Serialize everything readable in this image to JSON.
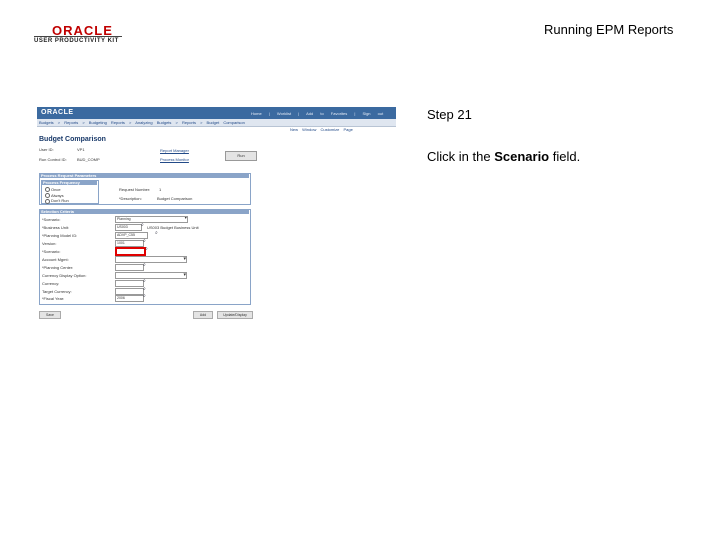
{
  "header": {
    "logo_text": "ORACLE",
    "logo_subtext": "USER PRODUCTIVITY KIT",
    "title": "Running EPM Reports"
  },
  "step": {
    "label": "Step 21",
    "instruction_prefix": "Click in the ",
    "instruction_field": "Scenario",
    "instruction_suffix": " field."
  },
  "screenshot": {
    "brand": "ORACLE",
    "top_links": "Home | Worklist | Add to Favorites | Sign out",
    "nav_links": "Budgets > Reports > Budgeting Reports > Analyzing Budgets > Reports > Budget Comparison",
    "util_links": "New Window  Customize Page",
    "page_title": "Budget Comparison",
    "fields": {
      "user_id_label": "User ID:",
      "user_id_value": "VP1",
      "run_control_label": "Run Control ID:",
      "run_control_value": "BUD_COMP",
      "report_manager": "Report Manager",
      "process_monitor": "Process Monitor",
      "run_button": "Run"
    },
    "process_section": {
      "header": "Process Request Parameters",
      "frequency_header": "Process Frequency",
      "options": [
        "Once",
        "Always",
        "Don't Run"
      ],
      "request_number_label": "Request Number:",
      "request_number_value": "1",
      "description_label": "*Description:",
      "description_value": "Budget Comparison"
    },
    "selection_section": {
      "header": "Selection Criteria",
      "rows": [
        {
          "label": "*Scenario:",
          "value": "Planning"
        },
        {
          "label": "*Business Unit:",
          "value": "US003"
        },
        {
          "label": "*Planning Model ID:",
          "value": "ADVP_C55"
        },
        {
          "label": "Version:",
          "value": "1001"
        },
        {
          "label": "*Scenario:",
          "value": ""
        },
        {
          "label": "Account Mgmt:",
          "value": ""
        },
        {
          "label": "*Planning Center:",
          "value": ""
        },
        {
          "label": "Currency Display Option:",
          "value": ""
        },
        {
          "label": "Currency:",
          "value": ""
        },
        {
          "label": "Target Currency:",
          "value": ""
        },
        {
          "label": "*Fiscal Year:",
          "value": "2006"
        }
      ],
      "bu_description": "US003 Budget Business Unit"
    },
    "bottom_buttons": {
      "save": "Save",
      "add": "Add",
      "update": "Update/Display"
    }
  }
}
